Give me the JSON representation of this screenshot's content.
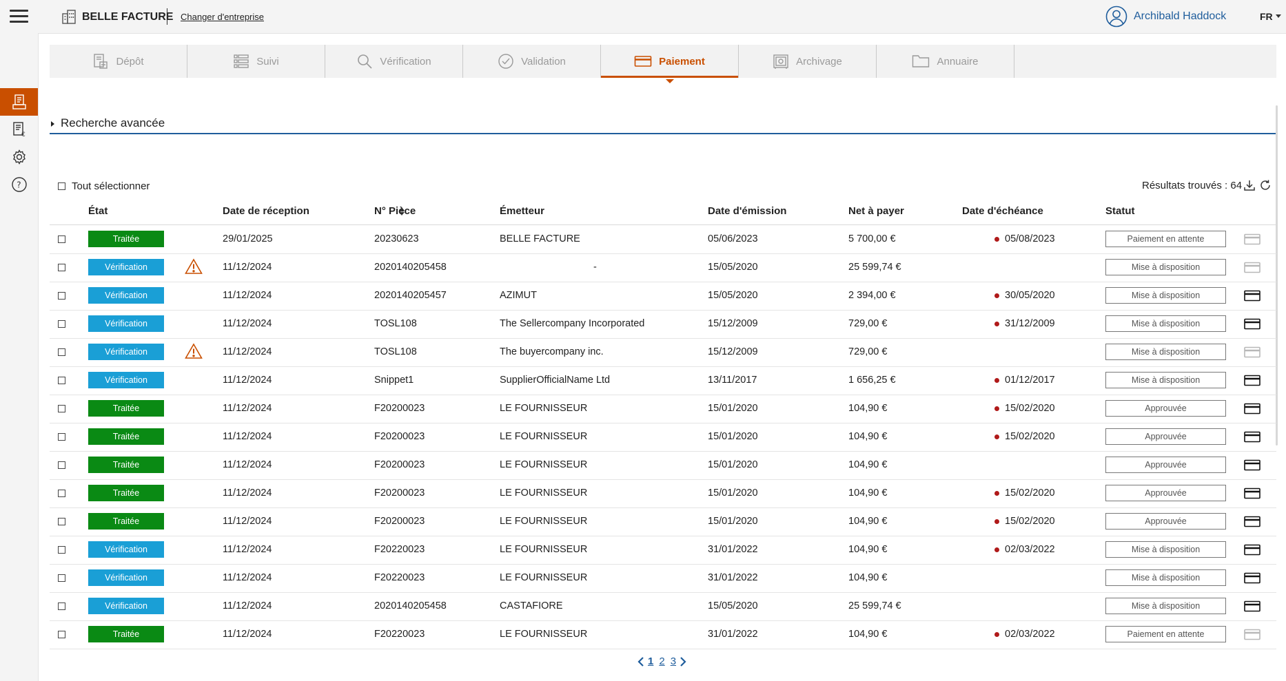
{
  "header": {
    "company": "BELLE FACTURE",
    "change_company": "Changer d'entreprise",
    "user": "Archibald Haddock",
    "lang": "FR"
  },
  "tabs": [
    {
      "label": "Dépôt",
      "icon": "deposit-icon",
      "active": false
    },
    {
      "label": "Suivi",
      "icon": "list-icon",
      "active": false
    },
    {
      "label": "Vérification",
      "icon": "search-icon",
      "active": false
    },
    {
      "label": "Validation",
      "icon": "check-circle-icon",
      "active": false
    },
    {
      "label": "Paiement",
      "icon": "card-icon",
      "active": true
    },
    {
      "label": "Archivage",
      "icon": "safe-icon",
      "active": false
    },
    {
      "label": "Annuaire",
      "icon": "folder-icon",
      "active": false
    }
  ],
  "advanced_search": "Recherche avancée",
  "select_all": "Tout sélectionner",
  "results": "Résultats trouvés : 64",
  "columns": {
    "etat": "État",
    "date_reception": "Date de réception",
    "piece": "N° Pièce",
    "emetteur": "Émetteur",
    "date_emission": "Date d'émission",
    "net": "Net à payer",
    "echeance": "Date d'échéance",
    "statut": "Statut"
  },
  "colors": {
    "traitee": "#0a8a14",
    "verification": "#1a9fd6",
    "accent": "#c94f00",
    "link": "#1f5d9c",
    "due_dot": "#b01a1a"
  },
  "rows": [
    {
      "etat": "Traitée",
      "warning": false,
      "date_reception": "29/01/2025",
      "piece": "20230623",
      "emetteur": "BELLE FACTURE",
      "date_emission": "05/06/2023",
      "net": "5 700,00 €",
      "echeance": "05/08/2023",
      "statut": "Paiement en attente",
      "card_active": false
    },
    {
      "etat": "Vérification",
      "warning": true,
      "date_reception": "11/12/2024",
      "piece": "2020140205458",
      "emetteur": "-",
      "date_emission": "15/05/2020",
      "net": "25 599,74 €",
      "echeance": "",
      "statut": "Mise à disposition",
      "card_active": false
    },
    {
      "etat": "Vérification",
      "warning": false,
      "date_reception": "11/12/2024",
      "piece": "2020140205457",
      "emetteur": "AZIMUT",
      "date_emission": "15/05/2020",
      "net": "2 394,00 €",
      "echeance": "30/05/2020",
      "statut": "Mise à disposition",
      "card_active": true
    },
    {
      "etat": "Vérification",
      "warning": false,
      "date_reception": "11/12/2024",
      "piece": "TOSL108",
      "emetteur": "The Sellercompany Incorporated",
      "date_emission": "15/12/2009",
      "net": "729,00 €",
      "echeance": "31/12/2009",
      "statut": "Mise à disposition",
      "card_active": true
    },
    {
      "etat": "Vérification",
      "warning": true,
      "date_reception": "11/12/2024",
      "piece": "TOSL108",
      "emetteur": "The buyercompany inc.",
      "date_emission": "15/12/2009",
      "net": "729,00 €",
      "echeance": "",
      "statut": "Mise à disposition",
      "card_active": false
    },
    {
      "etat": "Vérification",
      "warning": false,
      "date_reception": "11/12/2024",
      "piece": "Snippet1",
      "emetteur": "SupplierOfficialName Ltd",
      "date_emission": "13/11/2017",
      "net": "1 656,25 €",
      "echeance": "01/12/2017",
      "statut": "Mise à disposition",
      "card_active": true
    },
    {
      "etat": "Traitée",
      "warning": false,
      "date_reception": "11/12/2024",
      "piece": "F20200023",
      "emetteur": "LE FOURNISSEUR",
      "date_emission": "15/01/2020",
      "net": "104,90 €",
      "echeance": "15/02/2020",
      "statut": "Approuvée",
      "card_active": true
    },
    {
      "etat": "Traitée",
      "warning": false,
      "date_reception": "11/12/2024",
      "piece": "F20200023",
      "emetteur": "LE FOURNISSEUR",
      "date_emission": "15/01/2020",
      "net": "104,90 €",
      "echeance": "15/02/2020",
      "statut": "Approuvée",
      "card_active": true
    },
    {
      "etat": "Traitée",
      "warning": false,
      "date_reception": "11/12/2024",
      "piece": "F20200023",
      "emetteur": "LE FOURNISSEUR",
      "date_emission": "15/01/2020",
      "net": "104,90 €",
      "echeance": "",
      "statut": "Approuvée",
      "card_active": true
    },
    {
      "etat": "Traitée",
      "warning": false,
      "date_reception": "11/12/2024",
      "piece": "F20200023",
      "emetteur": "LE FOURNISSEUR",
      "date_emission": "15/01/2020",
      "net": "104,90 €",
      "echeance": "15/02/2020",
      "statut": "Approuvée",
      "card_active": true
    },
    {
      "etat": "Traitée",
      "warning": false,
      "date_reception": "11/12/2024",
      "piece": "F20200023",
      "emetteur": "LE FOURNISSEUR",
      "date_emission": "15/01/2020",
      "net": "104,90 €",
      "echeance": "15/02/2020",
      "statut": "Approuvée",
      "card_active": true
    },
    {
      "etat": "Vérification",
      "warning": false,
      "date_reception": "11/12/2024",
      "piece": "F20220023",
      "emetteur": "LE FOURNISSEUR",
      "date_emission": "31/01/2022",
      "net": "104,90 €",
      "echeance": "02/03/2022",
      "statut": "Mise à disposition",
      "card_active": true
    },
    {
      "etat": "Vérification",
      "warning": false,
      "date_reception": "11/12/2024",
      "piece": "F20220023",
      "emetteur": "LE FOURNISSEUR",
      "date_emission": "31/01/2022",
      "net": "104,90 €",
      "echeance": "",
      "statut": "Mise à disposition",
      "card_active": true
    },
    {
      "etat": "Vérification",
      "warning": false,
      "date_reception": "11/12/2024",
      "piece": "2020140205458",
      "emetteur": "CASTAFIORE",
      "date_emission": "15/05/2020",
      "net": "25 599,74 €",
      "echeance": "",
      "statut": "Mise à disposition",
      "card_active": true
    },
    {
      "etat": "Traitée",
      "warning": false,
      "date_reception": "11/12/2024",
      "piece": "F20220023",
      "emetteur": "LE FOURNISSEUR",
      "date_emission": "31/01/2022",
      "net": "104,90 €",
      "echeance": "02/03/2022",
      "statut": "Paiement en attente",
      "card_active": false
    }
  ],
  "pagination": {
    "pages": [
      "1",
      "2",
      "3"
    ],
    "current": "1"
  }
}
